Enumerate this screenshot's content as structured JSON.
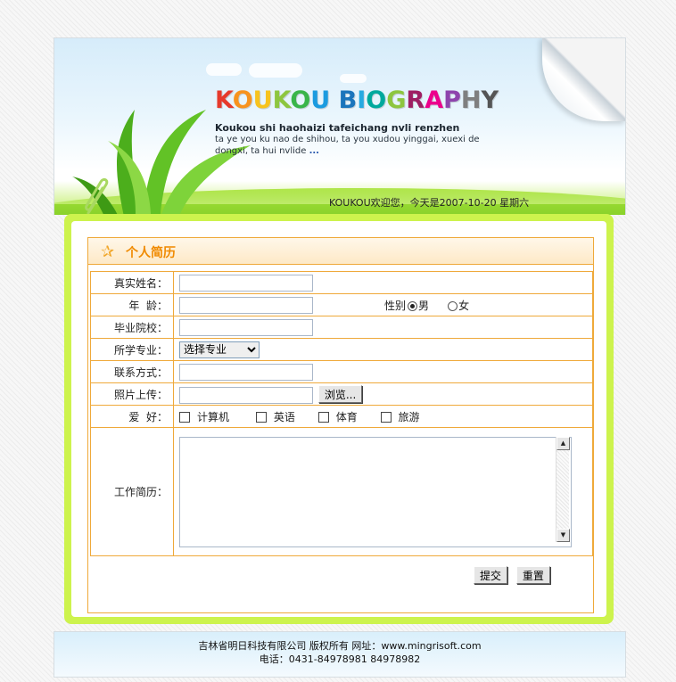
{
  "header": {
    "brand_letters": [
      {
        "ch": "K",
        "color": "#e63a2c"
      },
      {
        "ch": "O",
        "color": "#f7931e"
      },
      {
        "ch": "U",
        "color": "#f7c31e"
      },
      {
        "ch": "K",
        "color": "#8dc63f"
      },
      {
        "ch": "O",
        "color": "#39b54a"
      },
      {
        "ch": "U",
        "color": "#1b9be0"
      },
      {
        "ch": " ",
        "color": "#000000"
      },
      {
        "ch": "B",
        "color": "#1b75bc"
      },
      {
        "ch": "I",
        "color": "#27aae1"
      },
      {
        "ch": "O",
        "color": "#00a99d"
      },
      {
        "ch": "G",
        "color": "#8dc63f"
      },
      {
        "ch": "R",
        "color": "#9e1f63"
      },
      {
        "ch": "A",
        "color": "#ec008c"
      },
      {
        "ch": "P",
        "color": "#8e44ad"
      },
      {
        "ch": "H",
        "color": "#7f7f7f"
      },
      {
        "ch": "Y",
        "color": "#555555"
      }
    ],
    "subtitle_line1": "Koukou shi haohaizi tafeichang nvli renzhen",
    "subtitle_line2": "ta ye you ku nao de shihou, ta you xudou yinggai, xuexi de",
    "subtitle_line3": "dongxi, ta hui nvlide",
    "subtitle_more": "...",
    "welcome": "KOUKOU欢迎您，今天是2007-10-20 星期六"
  },
  "panel": {
    "title": "个人简历",
    "icon": "star-icon"
  },
  "form": {
    "name_label": "真实姓名：",
    "age_label": "年  龄：",
    "gender_label": "性别",
    "gender_male": "男",
    "gender_female": "女",
    "gender_selected": "男",
    "school_label": "毕业院校：",
    "major_label": "所学专业：",
    "major_selected": "选择专业",
    "contact_label": "联系方式：",
    "photo_label": "照片上传：",
    "browse_button": "浏览...",
    "hobby_label": "爱  好：",
    "hobbies": [
      "计算机",
      "英语",
      "体育",
      "旅游"
    ],
    "resume_label": "工作简历：",
    "submit_button": "提交",
    "reset_button": "重置"
  },
  "footer": {
    "line1": "吉林省明日科技有限公司 版权所有 网址：www.mingrisoft.com",
    "line2": "电话：0431-84978981 84978982"
  },
  "colors": {
    "accent_orange": "#efa93a",
    "title_orange": "#f08a00",
    "frame_green": "#cdf34d"
  }
}
